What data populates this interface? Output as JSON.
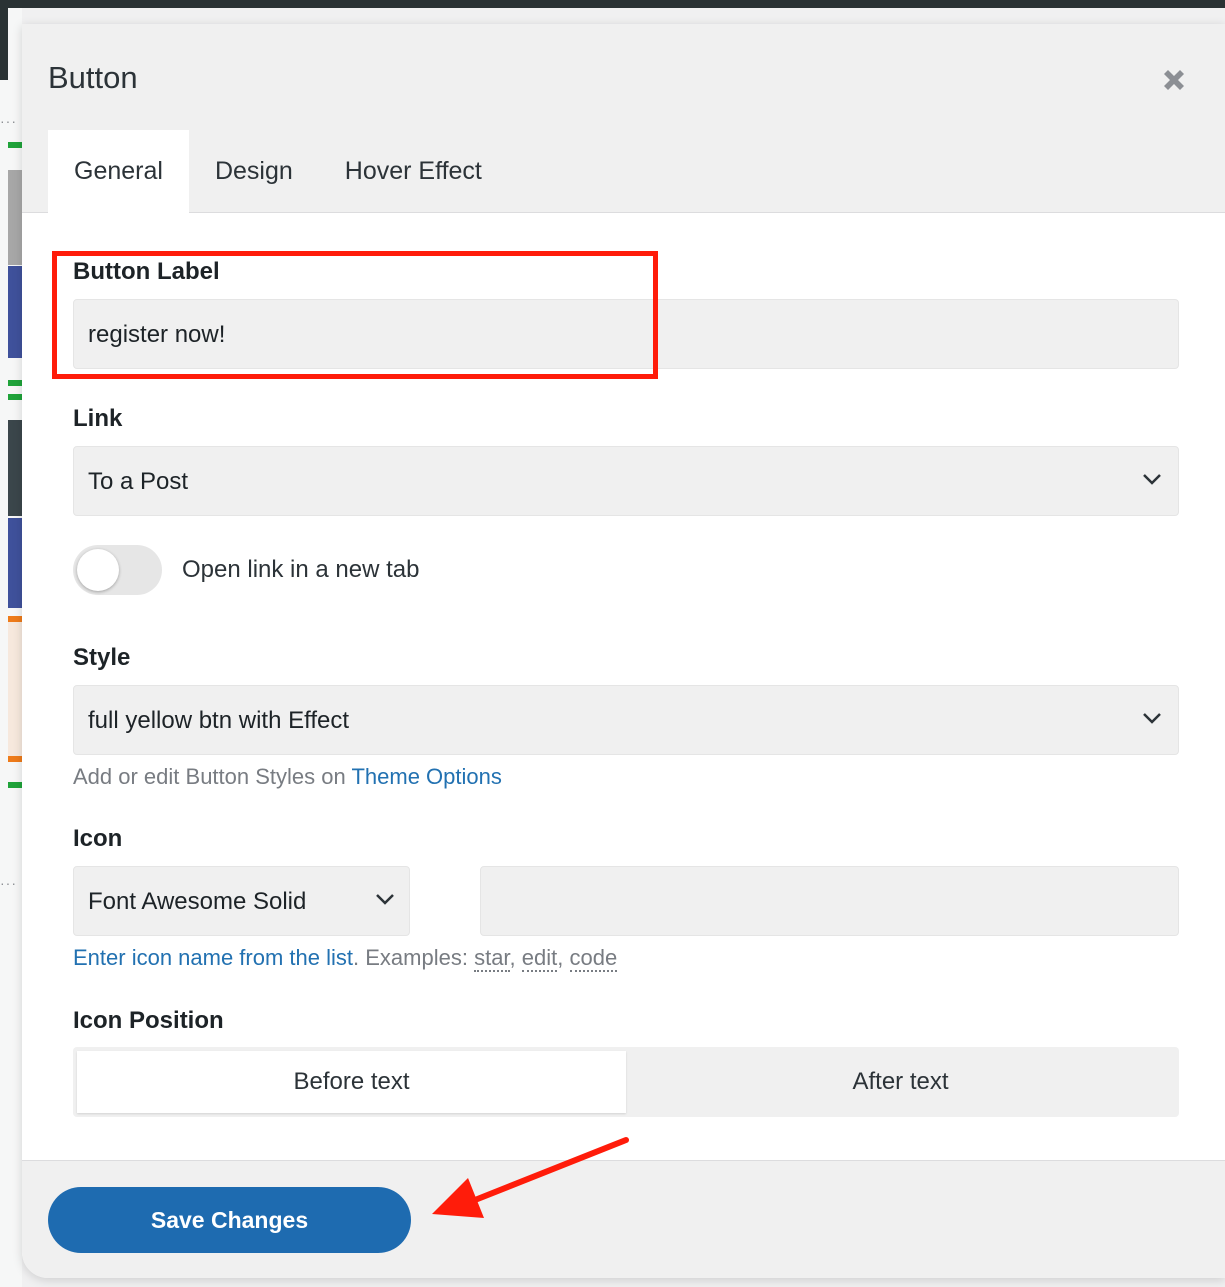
{
  "dialog": {
    "title": "Button",
    "tabs": [
      {
        "label": "General"
      },
      {
        "label": "Design"
      },
      {
        "label": "Hover Effect"
      }
    ]
  },
  "fields": {
    "button_label": {
      "label": "Button Label",
      "value": "register now!"
    },
    "link": {
      "label": "Link",
      "value": "To a Post"
    },
    "open_new_tab": {
      "label": "Open link in a new tab",
      "checked": false
    },
    "style": {
      "label": "Style",
      "value": "full yellow btn with Effect",
      "help_prefix": "Add or edit Button Styles on",
      "help_link": "Theme Options"
    },
    "icon": {
      "label": "Icon",
      "set_value": "Font Awesome Solid",
      "name_value": "",
      "help_link": "Enter icon name from the list",
      "help_examples": ". Examples:",
      "examples": [
        "star",
        "edit",
        "code"
      ]
    },
    "icon_position": {
      "label": "Icon Position",
      "options": [
        {
          "label": "Before text",
          "active": true
        },
        {
          "label": "After text",
          "active": false
        }
      ]
    }
  },
  "footer": {
    "save_label": "Save Changes"
  },
  "colors": {
    "primary": "#1e6bb0",
    "annotation": "#ff1c0a",
    "link": "#2271b1"
  }
}
